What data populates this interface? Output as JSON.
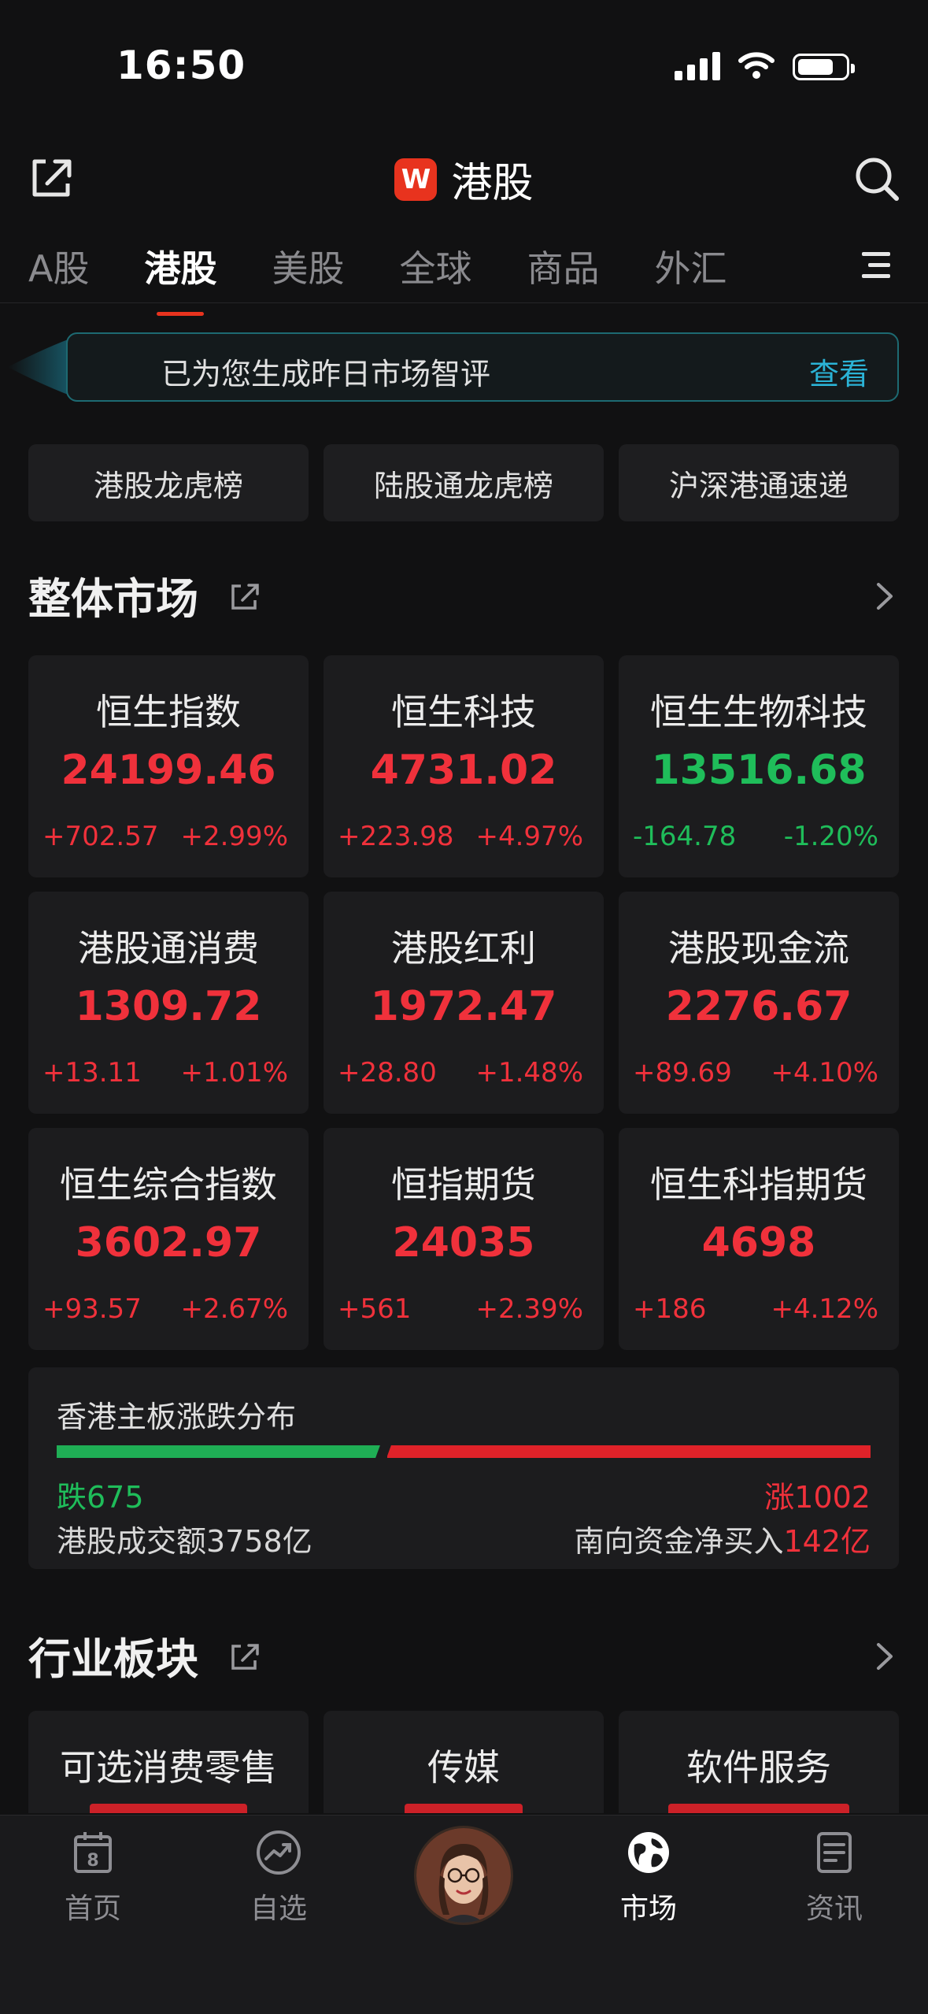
{
  "status_bar": {
    "time": "16:50"
  },
  "header": {
    "logo_text": "W",
    "title": "港股"
  },
  "tabs": [
    {
      "label": "A股",
      "active": false
    },
    {
      "label": "港股",
      "active": true
    },
    {
      "label": "美股",
      "active": false
    },
    {
      "label": "全球",
      "active": false
    },
    {
      "label": "商品",
      "active": false
    },
    {
      "label": "外汇",
      "active": false
    }
  ],
  "banner": {
    "text": "已为您生成昨日市场智评",
    "link": "查看"
  },
  "quick_buttons": [
    "港股龙虎榜",
    "陆股通龙虎榜",
    "沪深港通速递"
  ],
  "market_section": {
    "title": "整体市场"
  },
  "indices": [
    {
      "name": "恒生指数",
      "price": "24199.46",
      "change": "+702.57",
      "pct": "+2.99%",
      "trend": "up"
    },
    {
      "name": "恒生科技",
      "price": "4731.02",
      "change": "+223.98",
      "pct": "+4.97%",
      "trend": "up"
    },
    {
      "name": "恒生生物科技",
      "price": "13516.68",
      "change": "-164.78",
      "pct": "-1.20%",
      "trend": "down"
    },
    {
      "name": "港股通消费",
      "price": "1309.72",
      "change": "+13.11",
      "pct": "+1.01%",
      "trend": "up"
    },
    {
      "name": "港股红利",
      "price": "1972.47",
      "change": "+28.80",
      "pct": "+1.48%",
      "trend": "up"
    },
    {
      "name": "港股现金流",
      "price": "2276.67",
      "change": "+89.69",
      "pct": "+4.10%",
      "trend": "up"
    },
    {
      "name": "恒生综合指数",
      "price": "3602.97",
      "change": "+93.57",
      "pct": "+2.67%",
      "trend": "up"
    },
    {
      "name": "恒指期货",
      "price": "24035",
      "change": "+561",
      "pct": "+2.39%",
      "trend": "up"
    },
    {
      "name": "恒生科指期货",
      "price": "4698",
      "change": "+186",
      "pct": "+4.12%",
      "trend": "up"
    }
  ],
  "distribution": {
    "title": "香港主板涨跌分布",
    "down_label": "跌675",
    "up_label": "涨1002",
    "down_count": 675,
    "up_count": 1002,
    "turnover": "港股成交额3758亿",
    "southbound_label": "南向资金净买入",
    "southbound_value": "142亿"
  },
  "sector_section": {
    "title": "行业板块"
  },
  "sectors": [
    {
      "name": "可选消费零售"
    },
    {
      "name": "传媒"
    },
    {
      "name": "软件服务"
    }
  ],
  "bottom_nav": [
    {
      "label": "首页",
      "icon": "calendar-icon",
      "active": false
    },
    {
      "label": "自选",
      "icon": "trend-icon",
      "active": false
    },
    {
      "label": "",
      "icon": "avatar",
      "active": false
    },
    {
      "label": "市场",
      "icon": "globe-icon",
      "active": true
    },
    {
      "label": "资讯",
      "icon": "news-icon",
      "active": false
    }
  ],
  "colors": {
    "up": "#f0313b",
    "down": "#1fbd5a",
    "accent": "#e8331e",
    "link": "#2bb3d6"
  }
}
